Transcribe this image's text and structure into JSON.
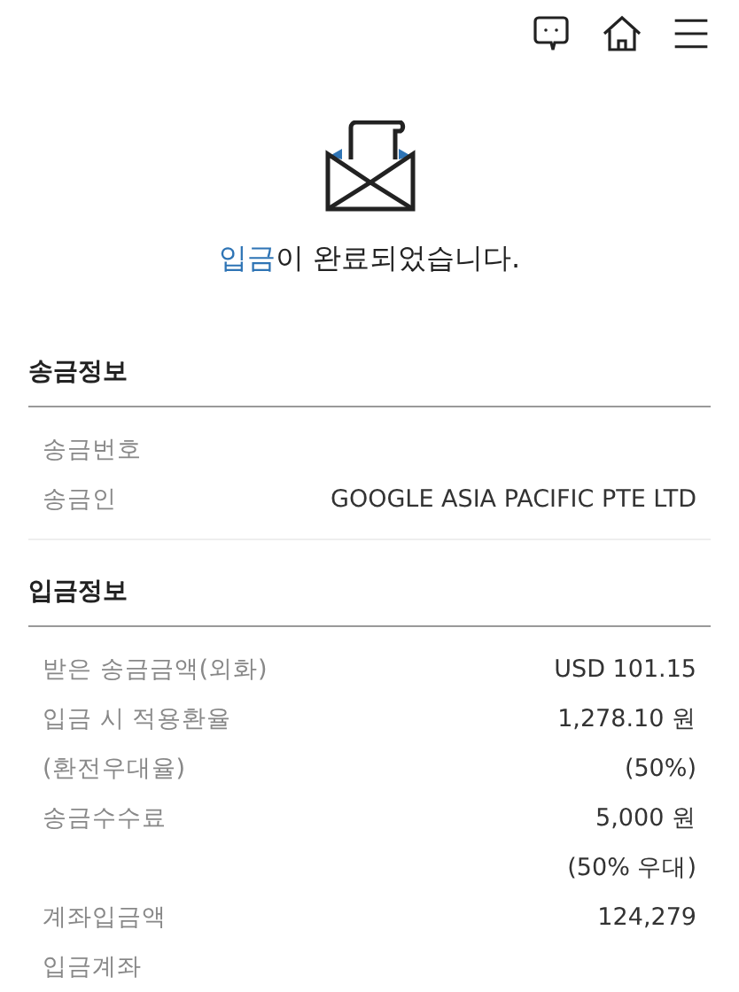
{
  "message": {
    "highlight": "입금",
    "text": "이 완료되었습니다."
  },
  "sections": [
    {
      "title": "송금정보",
      "rows": [
        {
          "label": "송금번호",
          "values": []
        },
        {
          "label": "송금인",
          "values": [
            "GOOGLE ASIA PACIFIC PTE LTD"
          ]
        }
      ]
    },
    {
      "title": "입금정보",
      "rows": [
        {
          "label": "받은 송금금액(외화)",
          "values": [
            "USD 101.15"
          ]
        },
        {
          "label": "입금 시 적용환율",
          "values": [
            "1,278.10 원"
          ]
        },
        {
          "label": "(환전우대율)",
          "values": [
            "(50%)"
          ]
        },
        {
          "label": "송금수수료",
          "values": [
            "5,000 원",
            "(50% 우대)"
          ]
        },
        {
          "label": "계좌입금액",
          "values": [
            "124,279"
          ]
        },
        {
          "label": "입금계좌",
          "values": []
        }
      ]
    }
  ]
}
